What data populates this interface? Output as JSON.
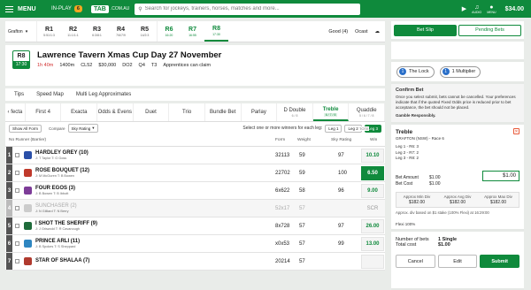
{
  "topbar": {
    "menu_label": "MENU",
    "inplay_label": "IN-PLAY",
    "inplay_count": "6",
    "brand": "TAB",
    "brand_suffix": ".COM.AU",
    "search_placeholder": "Search for jockeys, trainers, horses, matches and more...",
    "icons": [
      {
        "name": "play-icon",
        "label": ""
      },
      {
        "name": "audio-icon",
        "label": "AUDIO"
      },
      {
        "name": "user-icon",
        "label": "MENU"
      }
    ],
    "balance": "$34.00"
  },
  "race_nav": {
    "venue": "Grafton",
    "races": [
      {
        "label": "R1",
        "time": "5:51/1:3"
      },
      {
        "label": "R2",
        "time": "11:1/1:1"
      },
      {
        "label": "R3",
        "time": "6:3/8:1"
      },
      {
        "label": "R4",
        "time": "7/6/7/9"
      },
      {
        "label": "R5",
        "time": "14/2:3"
      },
      {
        "label": "R6",
        "time": "16:20"
      },
      {
        "label": "R7",
        "time": "16:55"
      },
      {
        "label": "R8",
        "time": "17:30"
      }
    ],
    "track_condition": "Good (4)",
    "weather": "Ocast"
  },
  "race_info": {
    "number": "R8",
    "time": "17:30",
    "title": "Lawrence Tavern Xmas Cup Day 27 November",
    "countdown": "1h 40m",
    "distance": "1400m",
    "class": "CL52",
    "prize": "$30,000",
    "extra1": "DO2",
    "extra2": "Q4",
    "extra3": "T3",
    "note": "Apprentices can claim"
  },
  "subtabs": [
    "Tips",
    "Speed Map",
    "Multi Leg Approximates"
  ],
  "bet_tabs": [
    {
      "label": "fecta",
      "sub": ""
    },
    {
      "label": "First 4",
      "sub": ""
    },
    {
      "label": "Exacta",
      "sub": ""
    },
    {
      "label": "Odds & Evens",
      "sub": ""
    },
    {
      "label": "Duet",
      "sub": ""
    },
    {
      "label": "Trio",
      "sub": ""
    },
    {
      "label": "Bundle Bet",
      "sub": ""
    },
    {
      "label": "Parlay",
      "sub": ""
    },
    {
      "label": "D Double",
      "sub": "6 / 8"
    },
    {
      "label": "Treble",
      "sub": "6 / 7 / 8"
    },
    {
      "label": "Quaddie",
      "sub": "5 / 6 / 7 / 8"
    }
  ],
  "controls": {
    "show_all_form": "Show All Form",
    "compare_label": "Compare",
    "compare_value": "Sky Rating",
    "hint": "Select one or more winners for each leg:",
    "legs": [
      "Leg 1",
      "Leg 2",
      "Leg 3"
    ]
  },
  "table_header": {
    "tote": "TOTE",
    "no": "No",
    "runner": "Runner (Barrier)",
    "form": "Form",
    "weight": "Weight",
    "sky": "Sky Rating",
    "win": "Win"
  },
  "runners": [
    {
      "no": "1",
      "name": "HARDLEY GREY (10)",
      "jt": "J: T Taylor  T: G Goss",
      "form": "32113",
      "weight": "59",
      "sky": "97",
      "win": "10.10",
      "silk": "#2a4fa8",
      "scratched": false,
      "selected": false
    },
    {
      "no": "2",
      "name": "ROSE BOUQUET (12)",
      "jt": "J: M McGuren  T: B Bowen",
      "form": "22702",
      "weight": "59",
      "sky": "100",
      "win": "6.50",
      "silk": "#c0392b",
      "scratched": false,
      "selected": true
    },
    {
      "no": "3",
      "name": "FOUR EGOS (3)",
      "jt": "J: B Bowen  T: B Ibbott",
      "form": "6x622",
      "weight": "58",
      "sky": "96",
      "win": "9.00",
      "silk": "#7d3c98",
      "scratched": false,
      "selected": false
    },
    {
      "no": "4",
      "name": "SUNCHASER (2)",
      "jt": "J: N Gilliard  T: N Berry",
      "form": "52x17",
      "weight": "57",
      "sky": "",
      "win": "SCR",
      "silk": "#cccccc",
      "scratched": true,
      "selected": false
    },
    {
      "no": "5",
      "name": "I SHOT THE SHERIFF (9)",
      "jt": "J: J Griswold  T: R Cavanough",
      "form": "8x728",
      "weight": "57",
      "sky": "97",
      "win": "26.00",
      "silk": "#1e6b3a",
      "scratched": false,
      "selected": false
    },
    {
      "no": "6",
      "name": "PRINCE ARLI (11)",
      "jt": "J: B Spokes  T: S Sheppard",
      "form": "x0x53",
      "weight": "57",
      "sky": "99",
      "win": "13.00",
      "silk": "#2e86c1",
      "scratched": false,
      "selected": false
    },
    {
      "no": "7",
      "name": "STAR OF SHALAA (7)",
      "jt": "",
      "form": "20214",
      "weight": "57",
      "sky": "",
      "win": "",
      "silk": "#b03a2e",
      "scratched": false,
      "selected": false
    }
  ],
  "betslip": {
    "tabs": [
      "Bet Slip",
      "Pending Bets"
    ],
    "pills": [
      {
        "icon": "1",
        "label": "The Lock"
      },
      {
        "icon": "1",
        "label": "1 Multiplier"
      }
    ],
    "confirm_title": "Confirm Bet",
    "confirm_text": "Once you select submit, bets cannot be cancelled. Your preferences indicate that if the quoted Fixed Odds price is reduced prior to bet acceptance, the bet should not be placed.",
    "gamble": "Gamble Responsibly.",
    "bet_type": "Treble",
    "bet_venue": "GRAFTON (NSW) - Race 6",
    "legs": [
      "Leg 1 - R6: 3",
      "Leg 2 - R7: 2",
      "Leg 3 - R8: 2"
    ],
    "bet_amount_label": "Bet Amount",
    "bet_amount": "$1.00",
    "bet_cost_label": "Bet Cost",
    "bet_cost": "$1.00",
    "stake": "$1.00",
    "div_min_label": "Approx Min Div",
    "div_min": "$182.00",
    "div_avg_label": "Approx Avg Div",
    "div_avg": "$182.00",
    "div_max_label": "Approx Max Div",
    "div_max": "$182.00",
    "approx_note": "Approx. div based on $1 stake (100% Flexi) at 16:29:00",
    "flexi": "Flexi 100%",
    "num_bets_label": "Number of bets",
    "num_bets": "1 Single",
    "total_cost_label": "Total cost",
    "total_cost": "$1.00",
    "cancel": "Cancel",
    "edit": "Edit",
    "submit": "Submit"
  }
}
